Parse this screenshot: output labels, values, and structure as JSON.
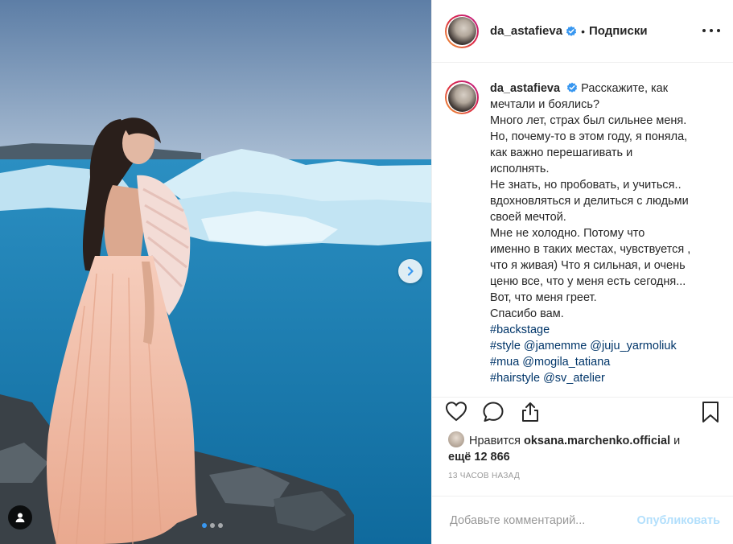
{
  "post": {
    "username": "da_astafieva",
    "follow_label": "Подписки",
    "separator": "•"
  },
  "caption": {
    "username": "da_astafieva",
    "lines": [
      "Расскажите, как",
      "мечтали и боялись?",
      "Много лет, страх был сильнее меня.",
      "Но, почему-то в этом году, я поняла,",
      "как важно перешагивать и",
      "исполнять.",
      "Не знать, но пробовать, и учиться..",
      "вдохновляться и делиться с людьми",
      "своей мечтой.",
      "Мне не холодно. Потому что",
      "именно в таких местах, чувствуется ,",
      "что я живая) Что я сильная, и очень",
      "ценю все, что у меня есть сегодня...",
      "Вот, что меня греет.",
      "Спасибо вам."
    ],
    "hashtags": [
      "#backstage",
      "#style @jamemme @juju_yarmoliuk",
      "#mua @mogila_tatiana",
      "#hairstyle @sv_atelier"
    ]
  },
  "likes": {
    "prefix": "Нравится",
    "liker": "oksana.marchenko.official",
    "and": "и",
    "others": "ещё 12 866"
  },
  "timestamp": "13 часов назад",
  "comment": {
    "placeholder": "Добавьте комментарий...",
    "publish_label": "Опубликовать"
  },
  "carousel": {
    "total": 3,
    "active": 1
  },
  "icons": {
    "like": "heart-icon",
    "comment": "comment-icon",
    "share": "share-icon",
    "save": "bookmark-icon",
    "more": "more-options-icon",
    "next": "chevron-right-icon",
    "tag": "user-tag-icon",
    "verified": "verified-badge-icon"
  },
  "colors": {
    "verified": "#3897f0",
    "publish_disabled": "#b2dffc",
    "hashtag": "#003569"
  }
}
